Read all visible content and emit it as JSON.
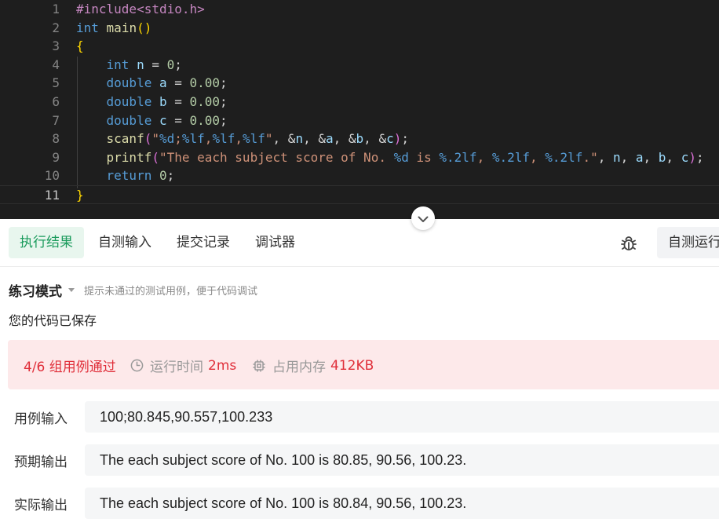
{
  "editor": {
    "line_numbers": [
      "1",
      "2",
      "3",
      "4",
      "5",
      "6",
      "7",
      "8",
      "9",
      "10",
      "11"
    ],
    "lines": [
      [
        {
          "t": "#include<stdio.h>",
          "c": "pp"
        }
      ],
      [
        {
          "t": "int",
          "c": "kw"
        },
        {
          "t": " ",
          "c": "op"
        },
        {
          "t": "main",
          "c": "fn"
        },
        {
          "t": "()",
          "c": "br1"
        }
      ],
      [
        {
          "t": "{",
          "c": "br1"
        }
      ],
      [
        {
          "t": "    ",
          "c": "op"
        },
        {
          "t": "int",
          "c": "kw"
        },
        {
          "t": " ",
          "c": "op"
        },
        {
          "t": "n",
          "c": "var"
        },
        {
          "t": " = ",
          "c": "op"
        },
        {
          "t": "0",
          "c": "num"
        },
        {
          "t": ";",
          "c": "op"
        }
      ],
      [
        {
          "t": "    ",
          "c": "op"
        },
        {
          "t": "double",
          "c": "kw"
        },
        {
          "t": " ",
          "c": "op"
        },
        {
          "t": "a",
          "c": "var"
        },
        {
          "t": " = ",
          "c": "op"
        },
        {
          "t": "0.00",
          "c": "num"
        },
        {
          "t": ";",
          "c": "op"
        }
      ],
      [
        {
          "t": "    ",
          "c": "op"
        },
        {
          "t": "double",
          "c": "kw"
        },
        {
          "t": " ",
          "c": "op"
        },
        {
          "t": "b",
          "c": "var"
        },
        {
          "t": " = ",
          "c": "op"
        },
        {
          "t": "0.00",
          "c": "num"
        },
        {
          "t": ";",
          "c": "op"
        }
      ],
      [
        {
          "t": "    ",
          "c": "op"
        },
        {
          "t": "double",
          "c": "kw"
        },
        {
          "t": " ",
          "c": "op"
        },
        {
          "t": "c",
          "c": "var"
        },
        {
          "t": " = ",
          "c": "op"
        },
        {
          "t": "0.00",
          "c": "num"
        },
        {
          "t": ";",
          "c": "op"
        }
      ],
      [
        {
          "t": "    ",
          "c": "op"
        },
        {
          "t": "scanf",
          "c": "fn"
        },
        {
          "t": "(",
          "c": "br2"
        },
        {
          "t": "\"",
          "c": "str"
        },
        {
          "t": "%d",
          "c": "fmt"
        },
        {
          "t": ";",
          "c": "str"
        },
        {
          "t": "%lf",
          "c": "fmt"
        },
        {
          "t": ",",
          "c": "str"
        },
        {
          "t": "%lf",
          "c": "fmt"
        },
        {
          "t": ",",
          "c": "str"
        },
        {
          "t": "%lf",
          "c": "fmt"
        },
        {
          "t": "\"",
          "c": "str"
        },
        {
          "t": ", &",
          "c": "op"
        },
        {
          "t": "n",
          "c": "var"
        },
        {
          "t": ", &",
          "c": "op"
        },
        {
          "t": "a",
          "c": "var"
        },
        {
          "t": ", &",
          "c": "op"
        },
        {
          "t": "b",
          "c": "var"
        },
        {
          "t": ", &",
          "c": "op"
        },
        {
          "t": "c",
          "c": "var"
        },
        {
          "t": ")",
          "c": "br2"
        },
        {
          "t": ";",
          "c": "op"
        }
      ],
      [
        {
          "t": "    ",
          "c": "op"
        },
        {
          "t": "printf",
          "c": "fn"
        },
        {
          "t": "(",
          "c": "br2"
        },
        {
          "t": "\"The each subject score of No. ",
          "c": "str"
        },
        {
          "t": "%d",
          "c": "fmt"
        },
        {
          "t": " is ",
          "c": "str"
        },
        {
          "t": "%.2lf",
          "c": "fmt"
        },
        {
          "t": ", ",
          "c": "str"
        },
        {
          "t": "%.2lf",
          "c": "fmt"
        },
        {
          "t": ", ",
          "c": "str"
        },
        {
          "t": "%.2lf",
          "c": "fmt"
        },
        {
          "t": ".\"",
          "c": "str"
        },
        {
          "t": ", ",
          "c": "op"
        },
        {
          "t": "n",
          "c": "var"
        },
        {
          "t": ", ",
          "c": "op"
        },
        {
          "t": "a",
          "c": "var"
        },
        {
          "t": ", ",
          "c": "op"
        },
        {
          "t": "b",
          "c": "var"
        },
        {
          "t": ", ",
          "c": "op"
        },
        {
          "t": "c",
          "c": "var"
        },
        {
          "t": ")",
          "c": "br2"
        },
        {
          "t": ";",
          "c": "op"
        }
      ],
      [
        {
          "t": "    ",
          "c": "op"
        },
        {
          "t": "return",
          "c": "kw"
        },
        {
          "t": " ",
          "c": "op"
        },
        {
          "t": "0",
          "c": "num"
        },
        {
          "t": ";",
          "c": "op"
        }
      ],
      [
        {
          "t": "}",
          "c": "br1"
        }
      ]
    ]
  },
  "tabs": {
    "items": [
      "执行结果",
      "自测输入",
      "提交记录",
      "调试器"
    ],
    "active": "执行结果",
    "run_label": "自测运行",
    "debug_icon": "bug-icon",
    "collapse_icon": "chevron-down-icon"
  },
  "result": {
    "mode_title": "练习模式",
    "mode_hint": "提示未通过的测试用例，便于代码调试",
    "saved_text": "您的代码已保存",
    "pass_text": "4/6 组用例通过",
    "time_label": "运行时间",
    "time_value": "2ms",
    "memory_label": "占用内存",
    "memory_value": "412KB",
    "input_label": "用例输入",
    "input_value": "100;80.845,90.557,100.233",
    "expected_label": "预期输出",
    "expected_value": "The each subject score of No. 100 is 80.85, 90.56, 100.23.",
    "actual_label": "实际输出",
    "actual_value": "The each subject score of No. 100 is 80.84, 90.56, 100.23."
  },
  "colors": {
    "accent_green": "#1a9b5c",
    "error_red": "#e02f3a",
    "editor_bg": "#1e1e1e"
  }
}
